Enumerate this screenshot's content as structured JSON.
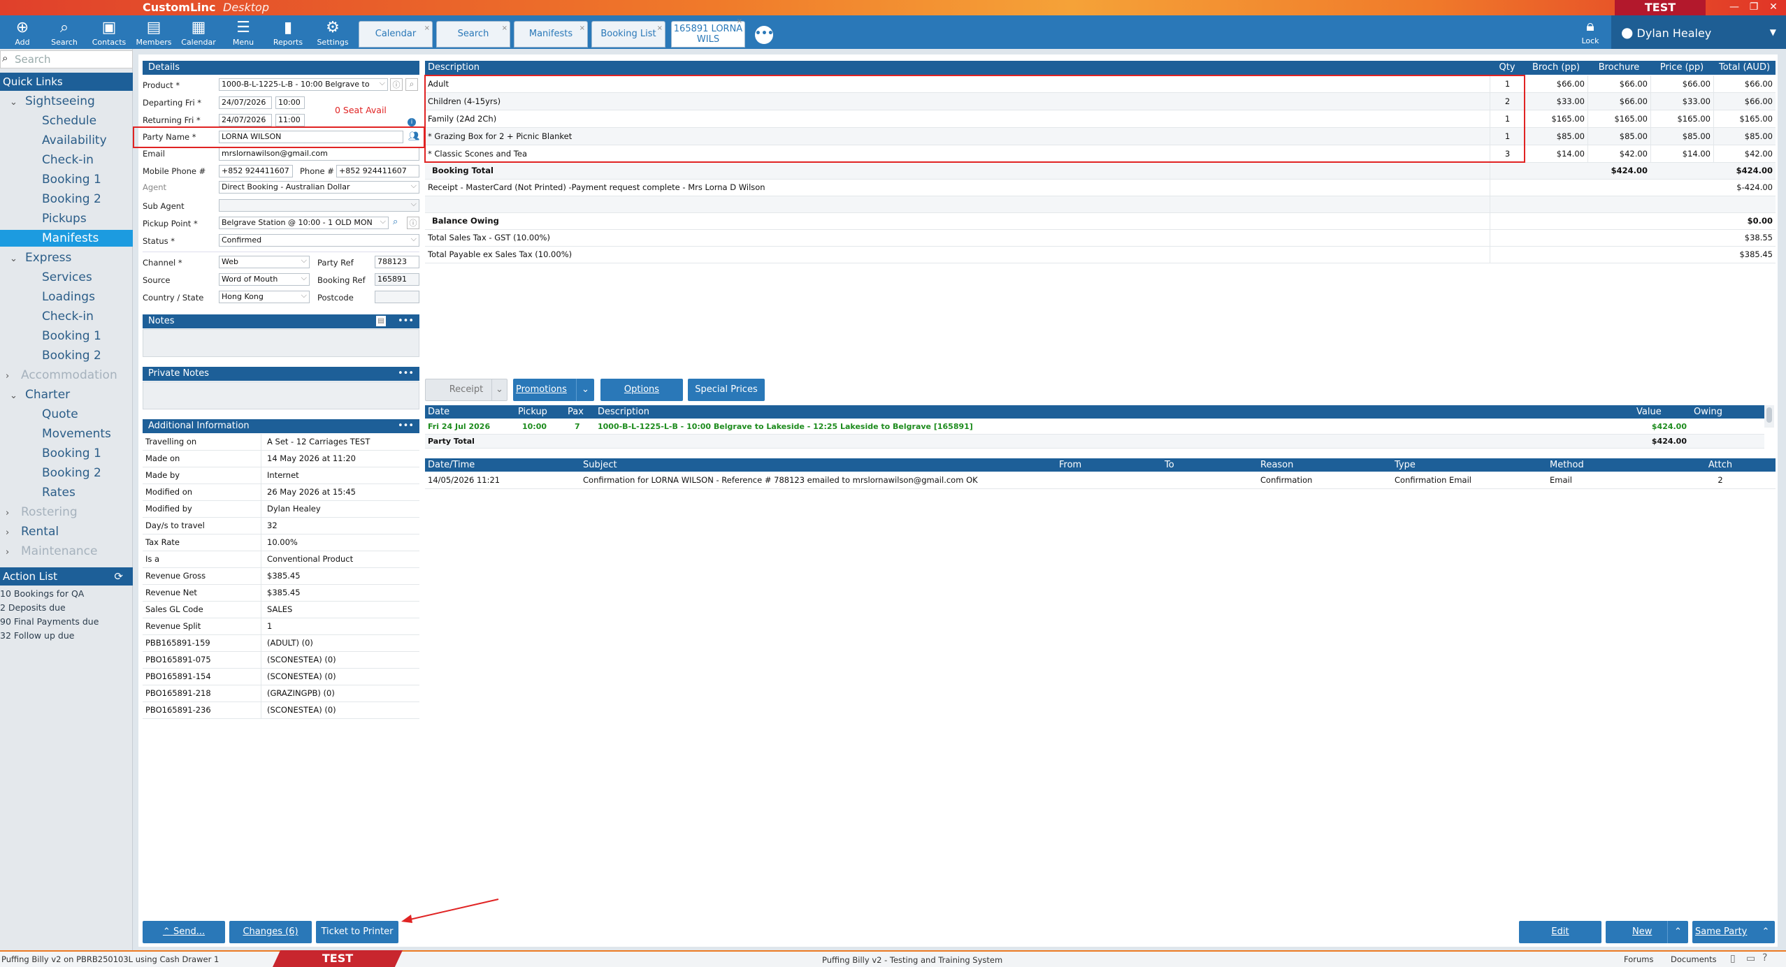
{
  "app": {
    "brand": "CustomLinc",
    "brand_sub": "Desktop",
    "env": "TEST",
    "user": "Dylan Healey"
  },
  "toolbar": {
    "items": [
      {
        "label": "Add",
        "icon": "plus-circle-icon"
      },
      {
        "label": "Search",
        "icon": "search-icon"
      },
      {
        "label": "Contacts",
        "icon": "contacts-icon"
      },
      {
        "label": "Members",
        "icon": "members-icon"
      },
      {
        "label": "Calendar",
        "icon": "calendar-icon"
      },
      {
        "label": "Menu",
        "icon": "menu-icon"
      },
      {
        "label": "Reports",
        "icon": "reports-icon"
      },
      {
        "label": "Settings",
        "icon": "gear-icon"
      }
    ],
    "lock_label": "Lock"
  },
  "tabs": [
    "Calendar",
    "Search",
    "Manifests",
    "Booking List",
    "165891 LORNA WILS"
  ],
  "sidebar": {
    "search_placeholder": "Search",
    "quick_links": "Quick Links",
    "groups": [
      {
        "label": "Sightseeing",
        "items": [
          "Schedule",
          "Availability",
          "Check-in",
          "Booking 1",
          "Booking 2",
          "Pickups",
          "Manifests"
        ]
      },
      {
        "label": "Express",
        "items": [
          "Services",
          "Loadings",
          "Check-in",
          "Booking 1",
          "Booking 2"
        ]
      },
      {
        "label": "Accommodation",
        "items": []
      },
      {
        "label": "Charter",
        "items": [
          "Quote",
          "Movements",
          "Booking 1",
          "Booking 2",
          "Rates"
        ]
      },
      {
        "label": "Rostering",
        "items": []
      },
      {
        "label": "Rental",
        "items": []
      },
      {
        "label": "Maintenance",
        "items": []
      }
    ],
    "action_list": "Action List",
    "actions": [
      "10 Bookings for QA",
      "2 Deposits due",
      "90 Final Payments due",
      "32 Follow up due"
    ]
  },
  "details": {
    "header": "Details",
    "product_label": "Product *",
    "product": "1000-B-L-1225-L-B - 10:00 Belgrave to",
    "departing_label": "Departing Fri *",
    "departing_date": "24/07/2026",
    "departing_time": "10:00",
    "returning_label": "Returning Fri *",
    "returning_date": "24/07/2026",
    "returning_time": "11:00",
    "seat_avail": "0 Seat Avail",
    "party_label": "Party Name *",
    "party": "LORNA WILSON",
    "email_label": "Email",
    "email": "mrslornawilson@gmail.com",
    "mobile_label": "Mobile Phone #",
    "mobile": "+852 924411607",
    "phone_label": "Phone #",
    "phone": "+852 924411607",
    "agent_label": "Agent",
    "agent": "Direct Booking - Australian Dollar",
    "subagent_label": "Sub Agent",
    "subagent": "",
    "pickup_label": "Pickup Point *",
    "pickup": "Belgrave Station @ 10:00 - 1 OLD MON",
    "status_label": "Status *",
    "status": "Confirmed",
    "channel_label": "Channel *",
    "channel": "Web",
    "partyref_label": "Party Ref",
    "partyref": "788123",
    "source_label": "Source",
    "source": "Word of Mouth",
    "bookingref_label": "Booking Ref",
    "bookingref": "165891",
    "country_label": "Country / State",
    "country": "Hong Kong",
    "postcode_label": "Postcode",
    "postcode": ""
  },
  "notes": {
    "header": "Notes",
    "private_header": "Private Notes"
  },
  "additional": {
    "header": "Additional Information",
    "rows": [
      [
        "Travelling on",
        "A Set - 12 Carriages TEST"
      ],
      [
        "Made on",
        "14 May 2026 at 11:20"
      ],
      [
        "Made by",
        "Internet"
      ],
      [
        "Modified on",
        "26 May 2026 at 15:45"
      ],
      [
        "Modified by",
        "Dylan Healey"
      ],
      [
        "Day/s to travel",
        "32"
      ],
      [
        "Tax Rate",
        "10.00%"
      ],
      [
        "Is a",
        "Conventional Product"
      ],
      [
        "Revenue Gross",
        "$385.45"
      ],
      [
        "Revenue Net",
        "$385.45"
      ],
      [
        "Sales GL Code",
        "SALES"
      ],
      [
        "Revenue Split",
        "1"
      ],
      [
        "PBB165891-159",
        "(ADULT) (0)"
      ],
      [
        "PBO165891-075",
        "(SCONESTEA) (0)"
      ],
      [
        "PBO165891-154",
        "(SCONESTEA) (0)"
      ],
      [
        "PBO165891-218",
        "(GRAZINGPB) (0)"
      ],
      [
        "PBO165891-236",
        "(SCONESTEA) (0)"
      ]
    ]
  },
  "items": {
    "headers": [
      "Description",
      "Qty",
      "Broch (pp)",
      "Brochure",
      "Price (pp)",
      "Total (AUD)"
    ],
    "rows": [
      [
        "Adult",
        "1",
        "$66.00",
        "$66.00",
        "$66.00",
        "$66.00"
      ],
      [
        "Children (4-15yrs)",
        "2",
        "$33.00",
        "$66.00",
        "$33.00",
        "$66.00"
      ],
      [
        "Family (2Ad 2Ch)",
        "1",
        "$165.00",
        "$165.00",
        "$165.00",
        "$165.00"
      ],
      [
        "* Grazing Box for 2 + Picnic Blanket",
        "1",
        "$85.00",
        "$85.00",
        "$85.00",
        "$85.00"
      ],
      [
        "* Classic Scones and Tea",
        "3",
        "$14.00",
        "$42.00",
        "$14.00",
        "$42.00"
      ]
    ],
    "booking_total_label": "Booking Total",
    "booking_total_brochure": "$424.00",
    "booking_total": "$424.00",
    "receipt_label": "Receipt - MasterCard (Not Printed) -Payment request complete - Mrs Lorna D Wilson",
    "receipt_amount": "$-424.00",
    "balance_label": "Balance Owing",
    "balance": "$0.00",
    "tax_label": "Total Sales Tax - GST (10.00%)",
    "tax": "$38.55",
    "extax_label": "Total Payable ex Sales Tax (10.00%)",
    "extax": "$385.45"
  },
  "actions_bar": {
    "receipt": "Receipt",
    "promotions": "Promotions",
    "options": "Options",
    "special": "Special Prices"
  },
  "legs": {
    "headers": [
      "Date",
      "Pickup",
      "Pax",
      "Description",
      "Value",
      "Owing"
    ],
    "row": [
      "Fri 24 Jul 2026",
      "10:00",
      "7",
      "1000-B-L-1225-L-B - 10:00 Belgrave to Lakeside - 12:25 Lakeside to Belgrave [165891]",
      "$424.00",
      ""
    ],
    "party_total_label": "Party Total",
    "party_total": "$424.00"
  },
  "comms": {
    "headers": [
      "Date/Time",
      "Subject",
      "From",
      "To",
      "Reason",
      "Type",
      "Method",
      "Attch"
    ],
    "row": [
      "14/05/2026 11:21",
      "Confirmation for LORNA WILSON - Reference # 788123 emailed to mrslornawilson@gmail.com OK",
      "",
      "",
      "Confirmation",
      "Confirmation Email",
      "Email",
      "2"
    ]
  },
  "bottom": {
    "send": "Send...",
    "changes": "Changes (6)",
    "ticket": "Ticket to Printer",
    "edit": "Edit",
    "new": "New",
    "same_party": "Same Party"
  },
  "statusbar": {
    "left": "Puffing Billy v2 on PBRB250103L using Cash Drawer 1",
    "env": "TEST",
    "center": "Puffing Billy v2 - Testing and Training System",
    "forums": "Forums",
    "documents": "Documents"
  },
  "colors": {
    "accent": "#1d5f98",
    "toolbar": "#2a78b8",
    "highlight": "#e02323",
    "leg_green": "#1e8c1e"
  }
}
